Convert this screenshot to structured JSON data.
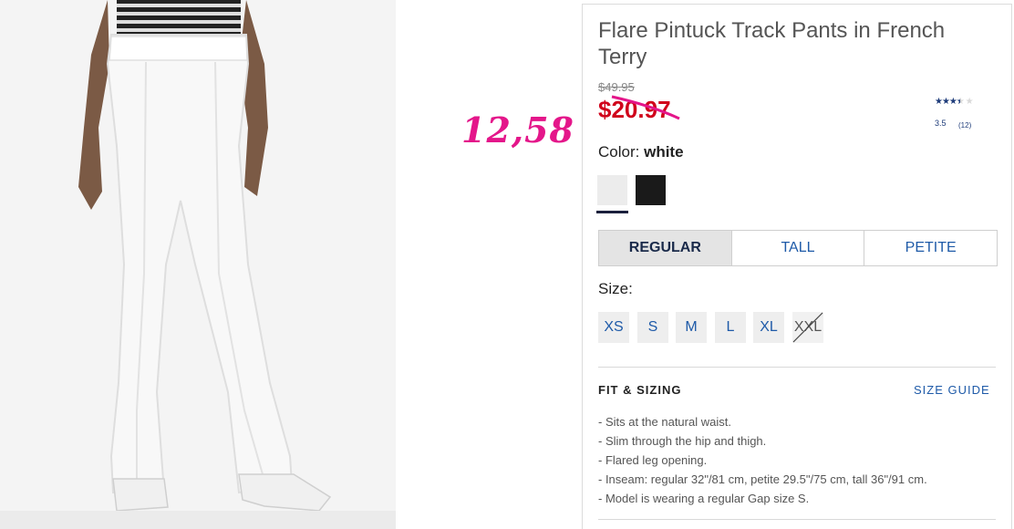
{
  "annotation": {
    "text": "12,58",
    "color": "#e4168a"
  },
  "product": {
    "title": "Flare Pintuck Track Pants in French Terry",
    "original_price": "$49.95",
    "sale_price": "$20.97",
    "sale_color": "#d0021b",
    "rating": {
      "value": "3.5",
      "count": "(12)",
      "stars_filled": 3.5,
      "stars_total": 5
    }
  },
  "color": {
    "label": "Color:",
    "selected": "white",
    "swatches": [
      "white",
      "black"
    ]
  },
  "fits": {
    "items": [
      "REGULAR",
      "TALL",
      "PETITE"
    ],
    "selected": "REGULAR"
  },
  "sizes": {
    "label": "Size:",
    "items": [
      "XS",
      "S",
      "M",
      "L",
      "XL",
      "XXL"
    ],
    "unavailable": [
      "XXL"
    ]
  },
  "fit_sizing": {
    "title": "FIT & SIZING",
    "guide_link": "SIZE GUIDE",
    "bullets": [
      "- Sits at the natural waist.",
      "- Slim through the hip and thigh.",
      "- Flared leg opening.",
      "- Inseam: regular 32\"/81 cm, petite 29.5\"/75 cm, tall 36\"/91 cm.",
      "- Model is wearing a regular Gap size S."
    ]
  }
}
